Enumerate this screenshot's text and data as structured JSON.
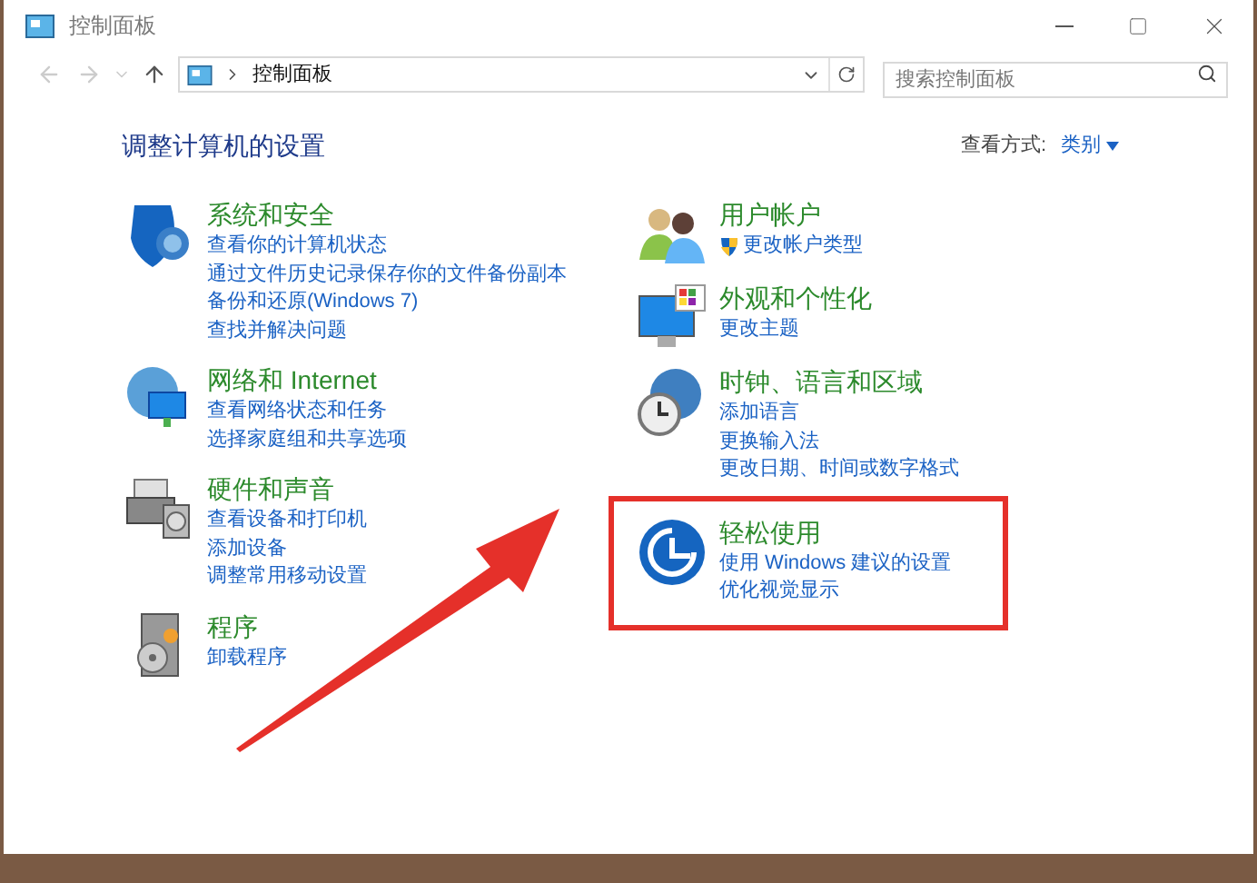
{
  "window": {
    "title": "控制面板"
  },
  "address_bar": {
    "path": "控制面板"
  },
  "search": {
    "placeholder": "搜索控制面板"
  },
  "heading": "调整计算机的设置",
  "view_by": {
    "label": "查看方式:",
    "value": "类别"
  },
  "left_categories": [
    {
      "title": "系统和安全",
      "highlighted": false,
      "links": [
        {
          "text": "查看你的计算机状态",
          "kind": "plain"
        },
        {
          "text": "通过文件历史记录保存你的文件备份副本",
          "kind": "plain"
        },
        {
          "text": "备份和还原(Windows 7)",
          "kind": "plain"
        },
        {
          "text": "查找并解决问题",
          "kind": "plain"
        }
      ]
    },
    {
      "title": "网络和 Internet",
      "highlighted": false,
      "links": [
        {
          "text": "查看网络状态和任务",
          "kind": "plain"
        },
        {
          "text": "选择家庭组和共享选项",
          "kind": "plain"
        }
      ]
    },
    {
      "title": "硬件和声音",
      "highlighted": false,
      "links": [
        {
          "text": "查看设备和打印机",
          "kind": "plain"
        },
        {
          "text": "添加设备",
          "kind": "plain"
        },
        {
          "text": "调整常用移动设置",
          "kind": "plain"
        }
      ]
    },
    {
      "title": "程序",
      "highlighted": false,
      "links": [
        {
          "text": "卸载程序",
          "kind": "plain"
        }
      ]
    }
  ],
  "right_categories": [
    {
      "title": "用户帐户",
      "highlighted": false,
      "links": [
        {
          "text": "更改帐户类型",
          "kind": "shield"
        }
      ]
    },
    {
      "title": "外观和个性化",
      "highlighted": false,
      "links": [
        {
          "text": "更改主题",
          "kind": "plain"
        }
      ]
    },
    {
      "title": "时钟、语言和区域",
      "highlighted": false,
      "links": [
        {
          "text": "添加语言",
          "kind": "plain"
        },
        {
          "text": "更换输入法",
          "kind": "plain"
        },
        {
          "text": "更改日期、时间或数字格式",
          "kind": "plain"
        }
      ]
    },
    {
      "title": "轻松使用",
      "highlighted": true,
      "links": [
        {
          "text": "使用 Windows 建议的设置",
          "kind": "plain"
        },
        {
          "text": "优化视觉显示",
          "kind": "plain"
        }
      ]
    }
  ]
}
